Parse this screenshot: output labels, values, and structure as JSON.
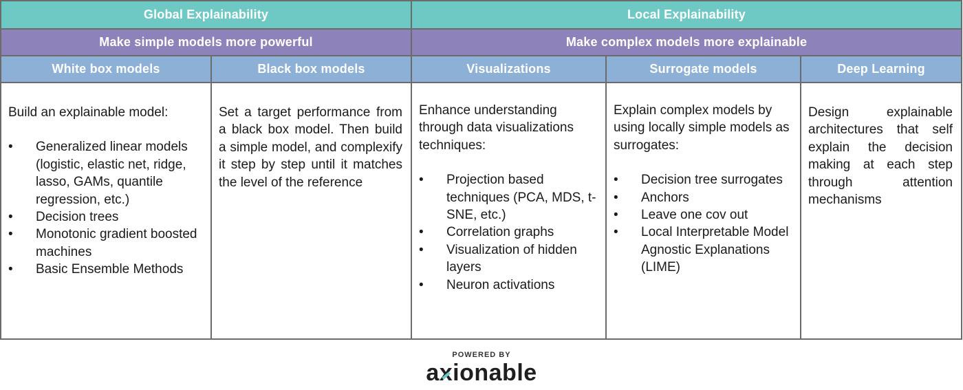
{
  "headers": {
    "global": "Global Explainability",
    "local": "Local Explainability",
    "global_sub": "Make simple models more powerful",
    "local_sub": "Make complex models more explainable"
  },
  "columns": [
    {
      "title": "White box models",
      "intro": "Build an explainable model:",
      "bullets": [
        "Generalized linear models (logistic, elastic net, ridge, lasso, GAMs, quantile regression, etc.)",
        "Decision trees",
        "Monotonic gradient boosted machines",
        "Basic Ensemble Methods"
      ]
    },
    {
      "title": "Black box models",
      "intro": "Set a target performance from a black box model. Then build a simple model, and complexify it step by step until it matches the level of the reference"
    },
    {
      "title": "Visualizations",
      "intro": "Enhance understanding through data visualizations techniques:",
      "bullets": [
        "Projection based techniques (PCA, MDS, t-SNE, etc.)",
        "Correlation graphs",
        "Visualization of hidden layers",
        "Neuron activations"
      ]
    },
    {
      "title": "Surrogate models",
      "intro": "Explain complex models by using locally simple models as surrogates:",
      "bullets": [
        "Decision tree surrogates",
        "Anchors",
        "Leave one cov out",
        "Local Interpretable Model Agnostic Explanations (LIME)"
      ]
    },
    {
      "title": "Deep Learning",
      "intro": "Design explainable architectures that self explain the decision making at each step through attention mechanisms"
    }
  ],
  "footer": {
    "powered": "POWERED BY",
    "logo_a": "a",
    "logo_x": "x",
    "logo_b": "ionable"
  },
  "colors": {
    "teal": "#6ec9c5",
    "purple": "#8d82b9",
    "blue": "#8db0d7"
  }
}
